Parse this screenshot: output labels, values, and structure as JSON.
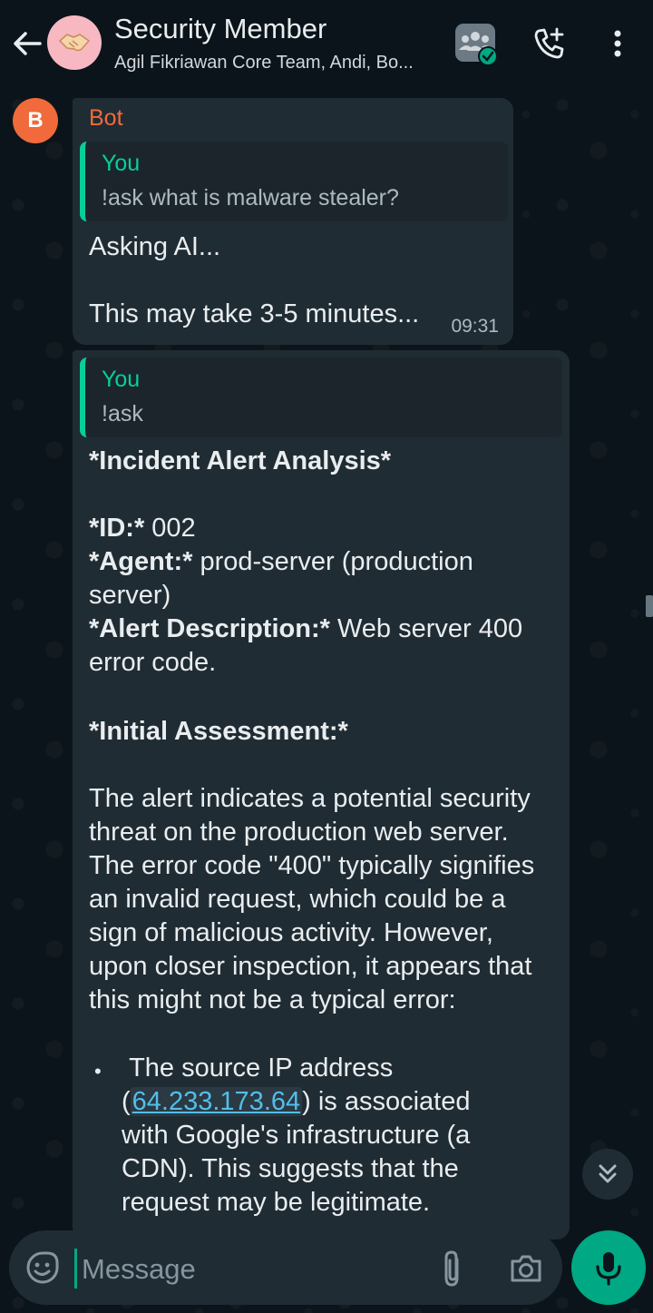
{
  "header": {
    "title": "Security Member",
    "subtitle": "Agil Fikriawan Core Team, Andi, Bo..."
  },
  "messages": [
    {
      "sender_initial": "B",
      "sender": "Bot",
      "quote_author": "You",
      "quote_text": "!ask what is malware stealer?",
      "line1": "Asking AI...",
      "line2": "This may take 3-5 minutes...",
      "time": "09:31"
    },
    {
      "quote_author": "You",
      "quote_text": "!ask",
      "heading": "*Incident Alert Analysis*",
      "id_label": "*ID:*",
      "id_value": " 002",
      "agent_label": "*Agent:*",
      "agent_value_1": " prod-server (production",
      "agent_value_2": "server)",
      "desc_label": "*Alert Description:*",
      "desc_value_1": " Web server 400",
      "desc_value_2": "error code.",
      "assessment_heading": "*Initial Assessment:*",
      "paragraph_lines": [
        "The alert indicates a potential security",
        "threat on the production web server.",
        "The error code \"400\" typically signifies",
        "an invalid request, which could be a",
        "sign of malicious activity. However,",
        "upon closer inspection, it appears that",
        "this might not be a typical error:"
      ],
      "bullet_line1": "The source IP address",
      "bullet_open": "(",
      "bullet_ip": "64.233.173.64",
      "bullet_after_ip": ") is associated",
      "bullet_line3": "with Google's infrastructure (a",
      "bullet_line4": "CDN). This suggests that the",
      "bullet_line5": "request may be legitimate.",
      "bullet_symbol": "•"
    }
  ],
  "input": {
    "placeholder": "Message"
  },
  "colors": {
    "accent": "#00a884",
    "sender_name": "#f06a3b",
    "quote_author": "#06cf9c",
    "link": "#53bdeb"
  },
  "icons": [
    "back-arrow-icon",
    "handshake-icon",
    "community-icon",
    "add-call-icon",
    "more-vert-icon",
    "chevron-double-down-icon",
    "emoji-icon",
    "paperclip-icon",
    "camera-icon",
    "microphone-icon"
  ]
}
